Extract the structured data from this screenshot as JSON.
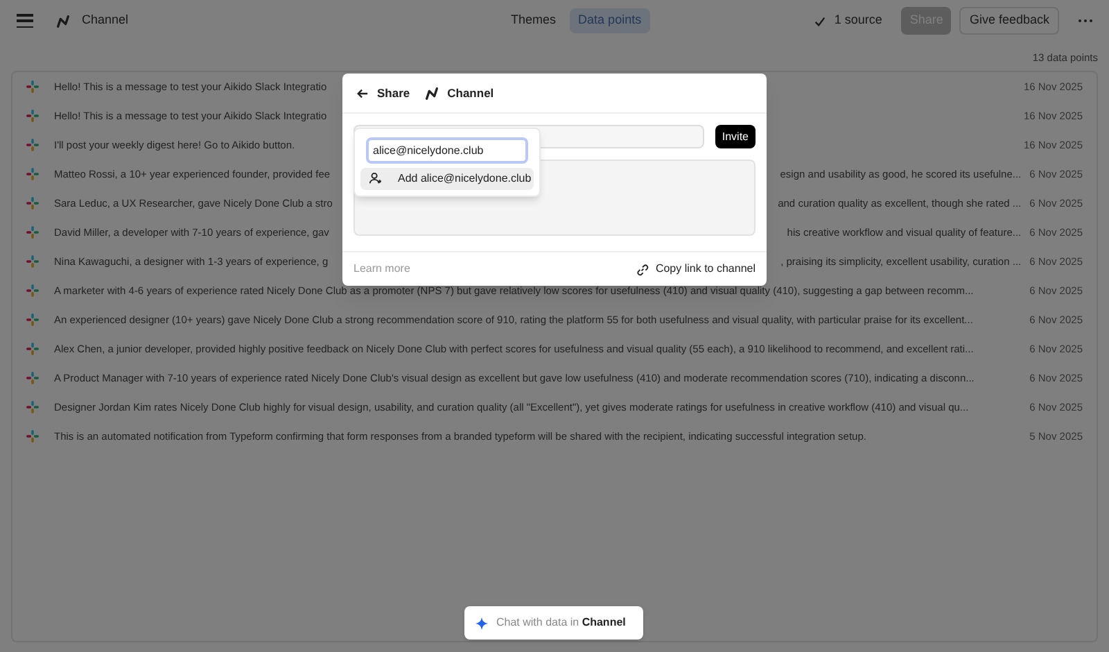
{
  "header": {
    "title": "Channel",
    "tabs": [
      {
        "label": "Themes",
        "selected": false
      },
      {
        "label": "Data points",
        "selected": true
      }
    ],
    "sources": "1 source",
    "share": "Share",
    "feedback": "Give feedback"
  },
  "count": "13 data points",
  "rows": [
    {
      "text": "Hello! This is a message to test your Aikido Slack Integratio",
      "date": "16 Nov 2025"
    },
    {
      "text": "Hello! This is a message to test your Aikido Slack Integratio",
      "date": "16 Nov 2025"
    },
    {
      "text": "I'll post your weekly digest here! Go to Aikido button.",
      "date": "16 Nov 2025"
    },
    {
      "text": "Matteo Rossi, a 10+ year experienced founder, provided fee",
      "text_right": "esign and usability as good, he scored its usefulne...",
      "date": "6 Nov 2025"
    },
    {
      "text": "Sara Leduc, a UX Researcher, gave Nicely Done Club a stro",
      "text_right": "and curation quality as excellent, though she rated ...",
      "date": "6 Nov 2025"
    },
    {
      "text": "David Miller, a developer with 7-10 years of experience, gav",
      "text_right": "his creative workflow and visual quality of feature...",
      "date": "6 Nov 2025"
    },
    {
      "text": "Nina Kawaguchi, a designer with 1-3 years of experience, g",
      "text_right": ", praising its simplicity, excellent usability, curation ...",
      "date": "6 Nov 2025"
    },
    {
      "text": "A marketer with 4-6 years of experience rated Nicely Done Club as a promoter (NPS 7) but gave relatively low scores for usefulness (410) and visual quality (410), suggesting a gap between recomm...",
      "date": "6 Nov 2025"
    },
    {
      "text": "An experienced designer (10+ years) gave Nicely Done Club a strong recommendation score of 910, rating the platform 55 for both usefulness and visual quality, with particular praise for its excellent...",
      "date": "6 Nov 2025"
    },
    {
      "text": "Alex Chen, a junior developer, provided highly positive feedback on Nicely Done Club with perfect scores for usefulness and visual quality (55 each), a 910 likelihood to recommend, and excellent rati...",
      "date": "6 Nov 2025"
    },
    {
      "text": "A Product Manager with 7-10 years of experience rated Nicely Done Club's visual design as excellent but gave low usefulness (410) and moderate recommendation scores (710), indicating a disconn...",
      "date": "6 Nov 2025"
    },
    {
      "text": "Designer Jordan Kim rates Nicely Done Club highly for visual design, usability, and curation quality (all \"Excellent\"), yet gives moderate ratings for usefulness in creative workflow (410) and visual qu...",
      "date": "6 Nov 2025"
    },
    {
      "text": "This is an automated notification from Typeform confirming that form responses from a branded typeform will be shared with the recipient, indicating successful integration setup.",
      "date": "5 Nov 2025"
    }
  ],
  "dialog": {
    "back_label": "Share",
    "channel": "Channel",
    "invite": "Invite",
    "email": "alice@nicelydone.club",
    "suggestion": "Add alice@nicelydone.club",
    "learn_more": "Learn more",
    "copy_link": "Copy link to channel"
  },
  "chat_prompt": "Chat with data in **Channel**"
}
